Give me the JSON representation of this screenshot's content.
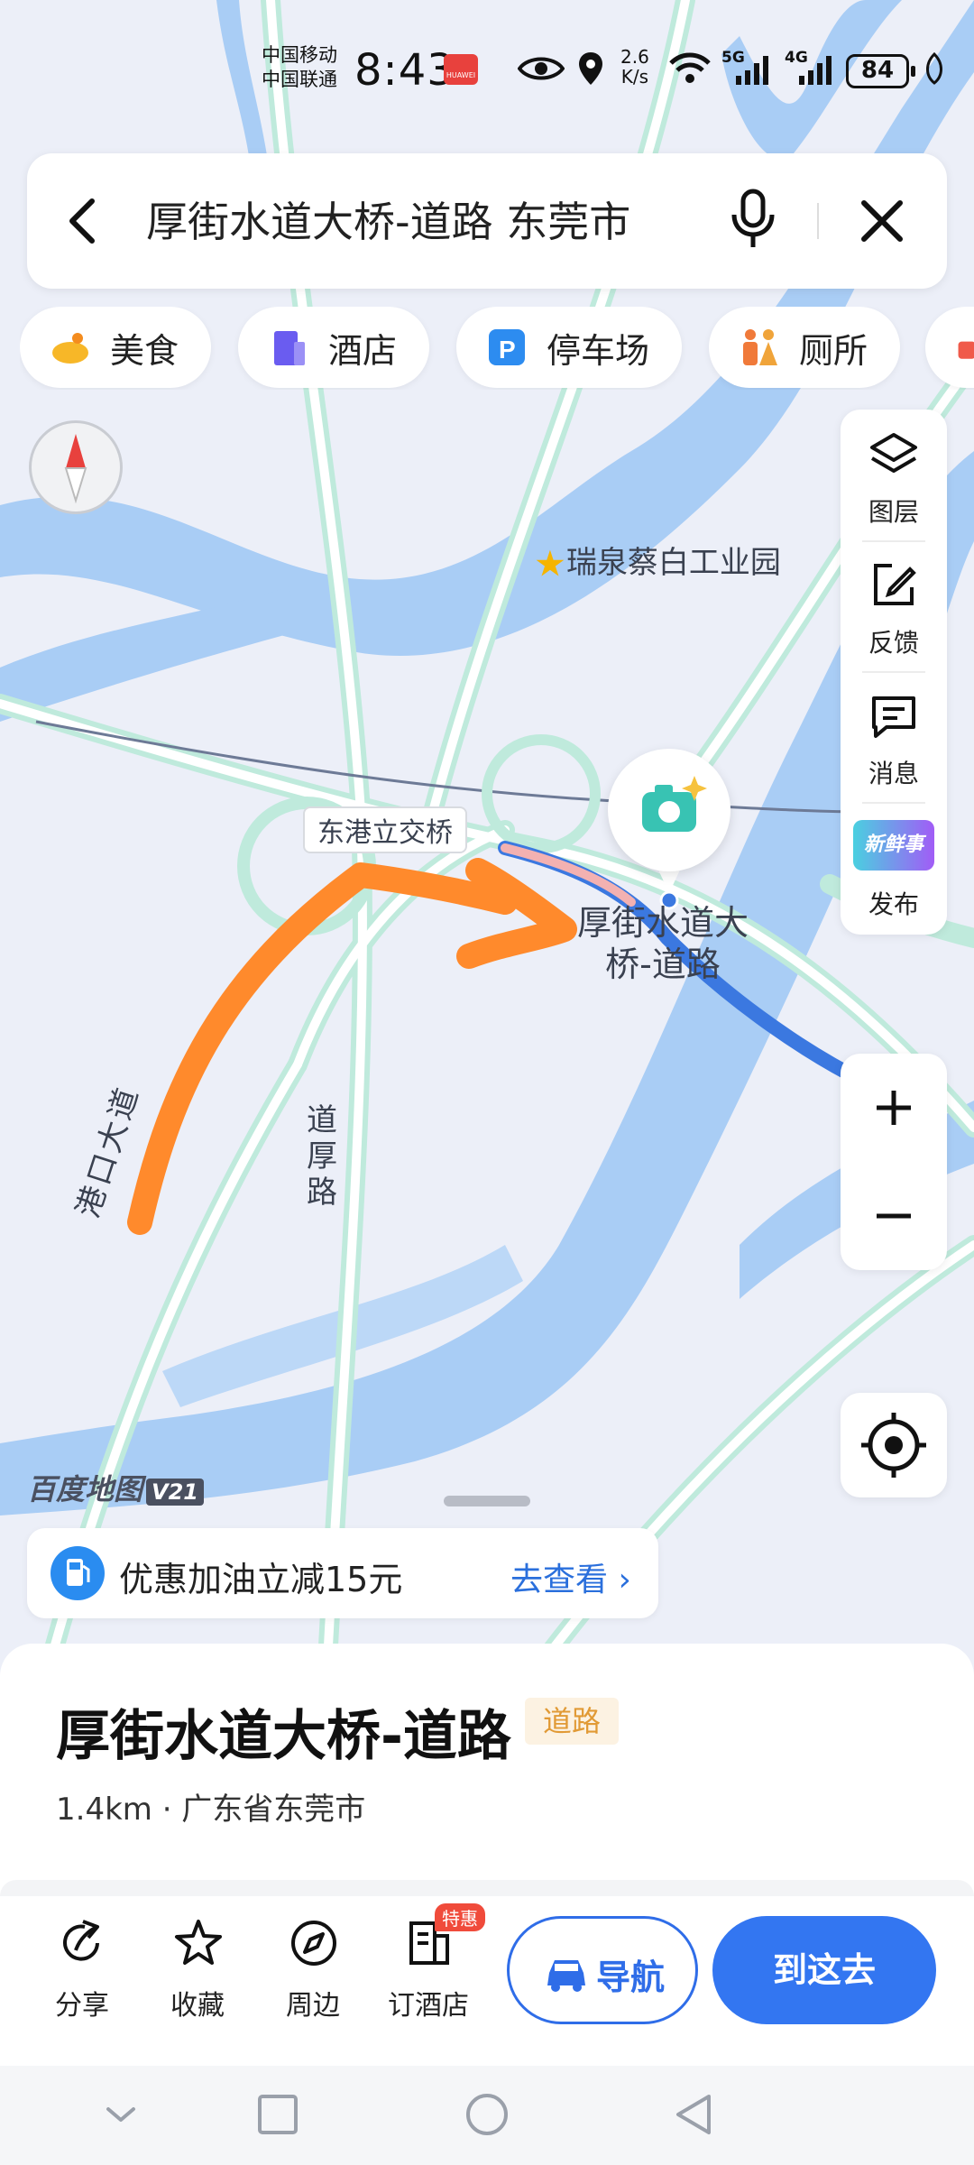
{
  "status_bar": {
    "carrier_1": "中国移动",
    "carrier_2": "中国联通",
    "time": "8:43",
    "net_speed_value": "2.6",
    "net_speed_unit": "K/s",
    "battery": "84",
    "signal_1": "5G",
    "signal_2": "4G"
  },
  "search": {
    "query": "厚街水道大桥-道路 东莞市"
  },
  "chips": [
    {
      "label": "美食",
      "icon": "food-icon"
    },
    {
      "label": "酒店",
      "icon": "hotel-icon"
    },
    {
      "label": "停车场",
      "icon": "parking-icon"
    },
    {
      "label": "厕所",
      "icon": "toilet-icon"
    }
  ],
  "tools": {
    "layers": "图层",
    "feedback": "反馈",
    "messages": "消息",
    "publish": "发布",
    "publish_badge": "新鲜事"
  },
  "map": {
    "poi_park": "瑞泉蔡白工业园",
    "interchange": "东港立交桥",
    "road_gangkou": "港口大道",
    "road_daohou": "道厚路",
    "selected_road_line1": "厚街水道大",
    "selected_road_line2": "桥-道路",
    "watermark": "百度地图",
    "watermark_version": "V21"
  },
  "promo": {
    "text": "优惠加油立减15元",
    "link": "去查看"
  },
  "place": {
    "title": "厚街水道大桥-道路",
    "tag": "道路",
    "meta": "1.4km · 广东省东莞市"
  },
  "actions": {
    "share": "分享",
    "favorite": "收藏",
    "nearby": "周边",
    "hotel": "订酒店",
    "hotel_badge": "特惠",
    "navigate": "导航",
    "go": "到这去"
  },
  "colors": {
    "accent": "#3376f1",
    "water": "#a9cdf5",
    "road": "#bfeadc",
    "annotation_arrow": "#ff8a2c",
    "selected_road": "#3b78e0"
  }
}
